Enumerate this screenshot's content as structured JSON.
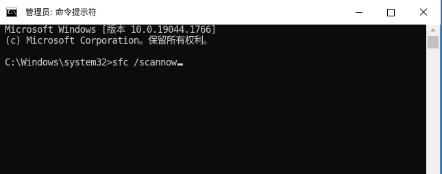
{
  "window": {
    "title": "管理员: 命令提示符",
    "icon_label": "C:\\",
    "icon": "cmd-icon"
  },
  "caption_buttons": {
    "minimize": "minimize-icon",
    "maximize": "maximize-icon",
    "close": "close-icon"
  },
  "console": {
    "lines": [
      "Microsoft Windows [版本 10.0.19044.1766]",
      "(c) Microsoft Corporation。保留所有权利。",
      "",
      "C:\\Windows\\system32>sfc /scannow"
    ]
  },
  "colors": {
    "console_bg": "#0c0c0c",
    "console_text": "#cccccc",
    "titlebar_bg": "#ffffff",
    "desktop": "#1b70c9"
  }
}
